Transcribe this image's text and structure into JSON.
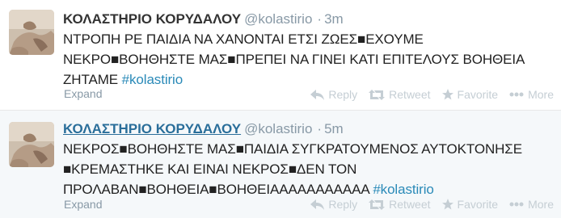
{
  "tweets": [
    {
      "fullname": "ΚΟΛΑΣΤΗΡΙΟ ΚΟΡΥΔΑΛΟΥ",
      "username": "@kolastirio",
      "time": "3m",
      "text_lines": [
        "ΝΤΡΟΠΗ ΡΕ ΠΑΙΔΙΑ ΝΑ ΧΑΝΟΝΤΑΙ ΕΤΣΙ ΖΩΕΣ■ΕΧΟΥΜΕ",
        "ΝΕΚΡΟ■ΒΟΗΘΗΣΤΕ ΜΑΣ■ΠΡΕΠΕΙ ΝΑ ΓΙΝΕΙ ΚΑΤΙ ΕΠΙΤΕΛΟΥΣ ΒΟΗΘΕΙΑ",
        "ΖΗΤΑΜΕ "
      ],
      "hashtag": "#kolastirio",
      "expand": "Expand",
      "actions": {
        "reply": "Reply",
        "retweet": "Retweet",
        "favorite": "Favorite",
        "more": "More"
      }
    },
    {
      "fullname": "ΚΟΛΑΣΤΗΡΙΟ ΚΟΡΥΔΑΛΟΥ",
      "username": "@kolastirio",
      "time": "5m",
      "text_lines": [
        "ΝΕΚΡΟΣ■ΒΟΗΘΗΣΤΕ ΜΑΣ■ΠΑΙΔΙΑ ΣΥΓΚΡΑΤΟΥΜΕΝΟΣ ΑΥΤΟΚΤΟΝΗΣΕ",
        "■ΚΡΕΜΑΣΤΗΚΕ ΚΑΙ ΕΙΝΑΙ ΝΕΚΡΟΣ■ΔΕΝ ΤΟΝ",
        "ΠΡΟΛΑΒΑΝ■ΒΟΗΘΕΙΑ■ΒΟΗΘΕΙΑΑΑΑΑΑΑΑΑΑΑ "
      ],
      "hashtag": "#kolastirio",
      "expand": "Expand",
      "actions": {
        "reply": "Reply",
        "retweet": "Retweet",
        "favorite": "Favorite",
        "more": "More"
      }
    }
  ],
  "icons": {
    "avatar": "avatar-photo",
    "reply": "reply-icon",
    "retweet": "retweet-icon",
    "favorite": "star-icon",
    "more": "more-dots-icon"
  },
  "colors": {
    "link_blue": "#2a8ab8",
    "name_link": "#2a6e9a",
    "meta_gray": "#8899a6",
    "action_gray": "#c5ced4",
    "hover_bg": "#f5f8fa"
  }
}
